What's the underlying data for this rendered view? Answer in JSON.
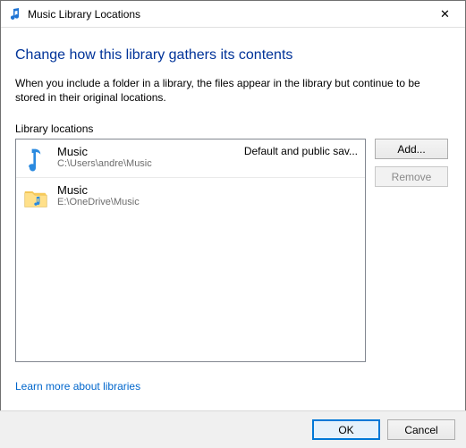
{
  "window": {
    "title": "Music Library Locations",
    "close_glyph": "✕"
  },
  "heading": "Change how this library gathers its contents",
  "description": "When you include a folder in a library, the files appear in the library but continue to be stored in their original locations.",
  "section_label": "Library locations",
  "locations": [
    {
      "name": "Music",
      "path": "C:\\Users\\andre\\Music",
      "extra": "Default and public sav..."
    },
    {
      "name": "Music",
      "path": "E:\\OneDrive\\Music",
      "extra": ""
    }
  ],
  "buttons": {
    "add": "Add...",
    "remove": "Remove",
    "ok": "OK",
    "cancel": "Cancel"
  },
  "link": "Learn more about libraries"
}
